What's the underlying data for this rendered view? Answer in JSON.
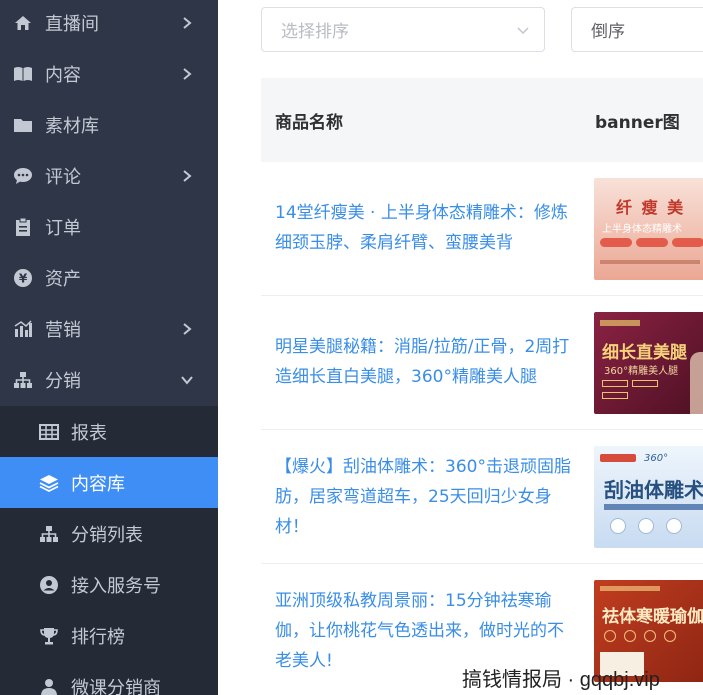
{
  "sidebar": {
    "items": [
      {
        "label": "直播间",
        "icon": "home-icon",
        "chevron": "right"
      },
      {
        "label": "内容",
        "icon": "book-icon",
        "chevron": "right"
      },
      {
        "label": "素材库",
        "icon": "folder-icon",
        "chevron": ""
      },
      {
        "label": "评论",
        "icon": "comment-icon",
        "chevron": "right"
      },
      {
        "label": "订单",
        "icon": "clipboard-icon",
        "chevron": ""
      },
      {
        "label": "资产",
        "icon": "coin-icon",
        "chevron": ""
      },
      {
        "label": "营销",
        "icon": "bar-chart-icon",
        "chevron": "right"
      },
      {
        "label": "分销",
        "icon": "sitemap-icon",
        "chevron": "down"
      }
    ],
    "subitems": [
      {
        "label": "报表",
        "icon": "table-icon"
      },
      {
        "label": "内容库",
        "icon": "layers-icon",
        "active": true
      },
      {
        "label": "分销列表",
        "icon": "sitemap-icon"
      },
      {
        "label": "接入服务号",
        "icon": "user-circle-icon"
      },
      {
        "label": "排行榜",
        "icon": "trophy-icon"
      },
      {
        "label": "微课分销商",
        "icon": "person-icon"
      }
    ]
  },
  "filters": {
    "sort_placeholder": "选择排序",
    "order_value": "倒序"
  },
  "table": {
    "headers": {
      "name": "商品名称",
      "banner": "banner图"
    },
    "rows": [
      {
        "name": "14堂纤瘦美 · 上半身体态精雕术：修炼细颈玉脖、柔肩纤臂、蛮腰美背",
        "banner": {
          "title": "纤 瘦 美",
          "subtitle": "上半身体态精雕术",
          "colors": [
            "#f6d9cf",
            "#e9a993"
          ]
        }
      },
      {
        "name": "明星美腿秘籍：消脂/拉筋/正骨，2周打造细长直白美腿，360°精雕美人腿",
        "banner": {
          "title": "细长直美腿",
          "subtitle": "360°精雕美人腿",
          "colors": [
            "#7a1c3a",
            "#4d1024"
          ]
        }
      },
      {
        "name": "【爆火】刮油体雕术：360°击退顽固脂肪，居家弯道超车，25天回归少女身材！",
        "banner": {
          "title": "刮油体雕术",
          "subtitle": "360°",
          "colors": [
            "#eaf2fb",
            "#c9dcf2"
          ]
        }
      },
      {
        "name": "亚洲顶级私教周景丽：15分钟祛寒瑜伽，让你桃花气色透出来，做时光的不老美人!",
        "banner": {
          "title": "祛体寒暖瑜伽",
          "subtitle": "",
          "colors": [
            "#b9341c",
            "#8c2212"
          ]
        }
      }
    ]
  },
  "watermark": "搞钱情报局 · gqqbj.vip"
}
